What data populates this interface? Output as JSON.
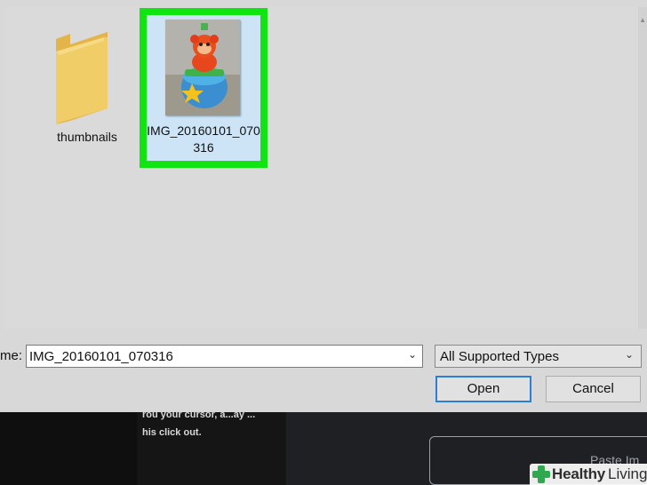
{
  "files": [
    {
      "name": "thumbnails",
      "kind": "folder"
    },
    {
      "name": "IMG_20160101_070316",
      "kind": "image",
      "selected": true
    }
  ],
  "filename": {
    "label": "me:",
    "value": "IMG_20160101_070316"
  },
  "file_type": {
    "selected": "All Supported Types"
  },
  "buttons": {
    "open_label": "Open",
    "cancel_label": "Cancel"
  },
  "background_app": {
    "text_line1": "rou your cursor, a...ay ...",
    "text_line2": "his click out.",
    "paste_label": "Paste Im"
  },
  "watermark": {
    "brand_bold": "Healthy",
    "brand_light": "Living"
  },
  "colors": {
    "selection_highlight": "#11e511",
    "selection_fill": "#cce4f6",
    "folder_yellow": "#f0c95a",
    "open_button_border": "#2c7fd6"
  }
}
